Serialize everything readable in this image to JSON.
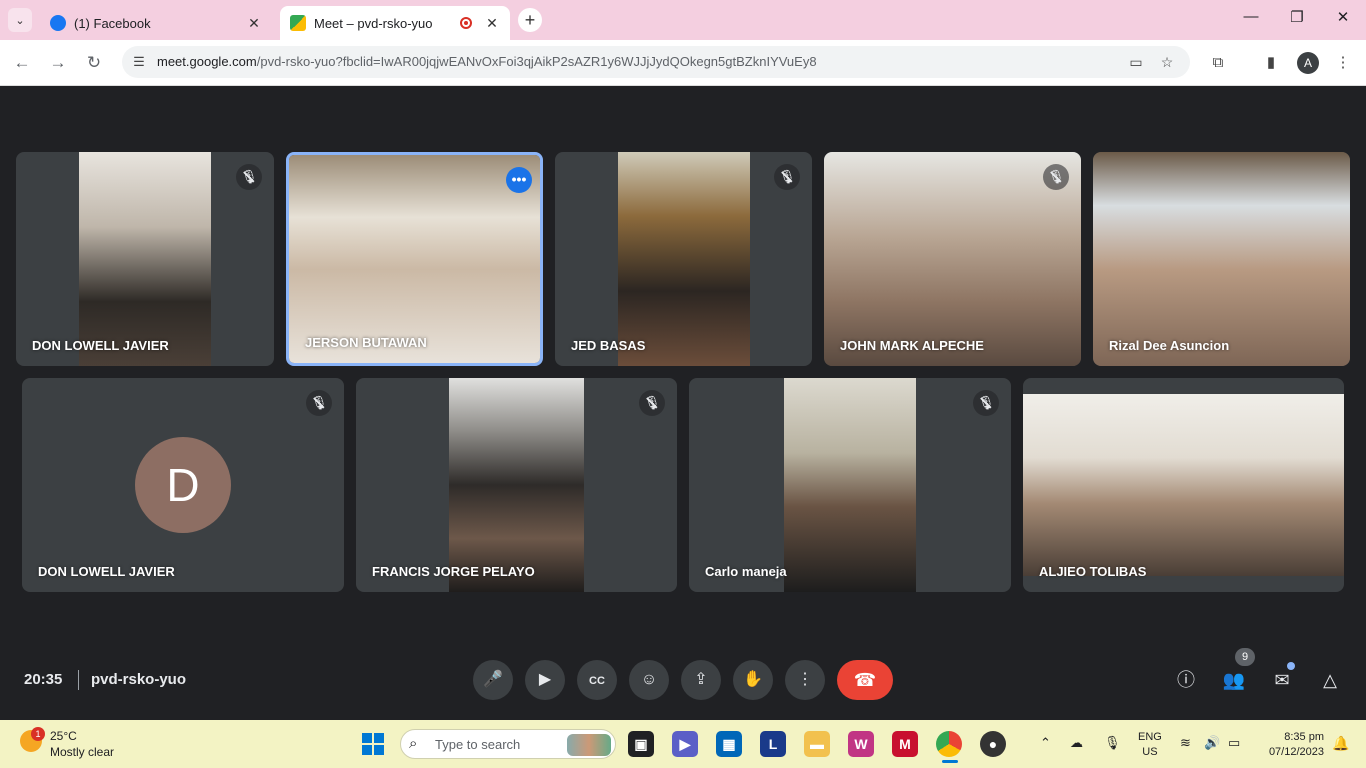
{
  "browser": {
    "tabs": [
      {
        "title": "(1) Facebook",
        "active": false
      },
      {
        "title": "Meet – pvd-rsko-yuo",
        "active": true
      }
    ],
    "url_host": "meet.google.com",
    "url_path": "/pvd-rsko-yuo?fbclid=IwAR00jqjwEANvOxFoi3qjAikP2sAZR1y6WJJjJydQOkegn5gtBZknIYVuEy8",
    "profile_initial": "A",
    "colors": {
      "tabstrip": "#f4cfe0",
      "facebook": "#1877f2"
    }
  },
  "meet": {
    "participants": [
      {
        "name": "DON LOWELL JAVIER",
        "muted": true,
        "video": "camera"
      },
      {
        "name": "JERSON BUTAWAN",
        "muted": false,
        "video": "camera",
        "selected": true
      },
      {
        "name": "JED BASAS",
        "muted": true,
        "video": "camera"
      },
      {
        "name": "JOHN MARK ALPECHE",
        "muted": true,
        "video": "camera"
      },
      {
        "name": "Rizal Dee Asuncion",
        "muted": false,
        "video": "camera"
      },
      {
        "name": "DON LOWELL JAVIER",
        "muted": true,
        "video": "avatar",
        "initial": "D"
      },
      {
        "name": "FRANCIS JORGE PELAYO",
        "muted": true,
        "video": "camera"
      },
      {
        "name": "Carlo maneja",
        "muted": true,
        "video": "camera"
      },
      {
        "name": "ALJIEO TOLIBAS",
        "muted": false,
        "video": "camera"
      }
    ],
    "time": "20:35",
    "meeting_code": "pvd-rsko-yuo",
    "participant_count": "9",
    "colors": {
      "end_call": "#ea4335",
      "selected_border": "#8ab4f8",
      "tile": "#3c4043",
      "background": "#202124"
    }
  },
  "taskbar": {
    "weather_badge": "1",
    "temperature": "25°C",
    "condition": "Mostly clear",
    "search_placeholder": "Type to search",
    "language_line1": "ENG",
    "language_line2": "US",
    "time": "8:35 pm",
    "date": "07/12/2023"
  }
}
